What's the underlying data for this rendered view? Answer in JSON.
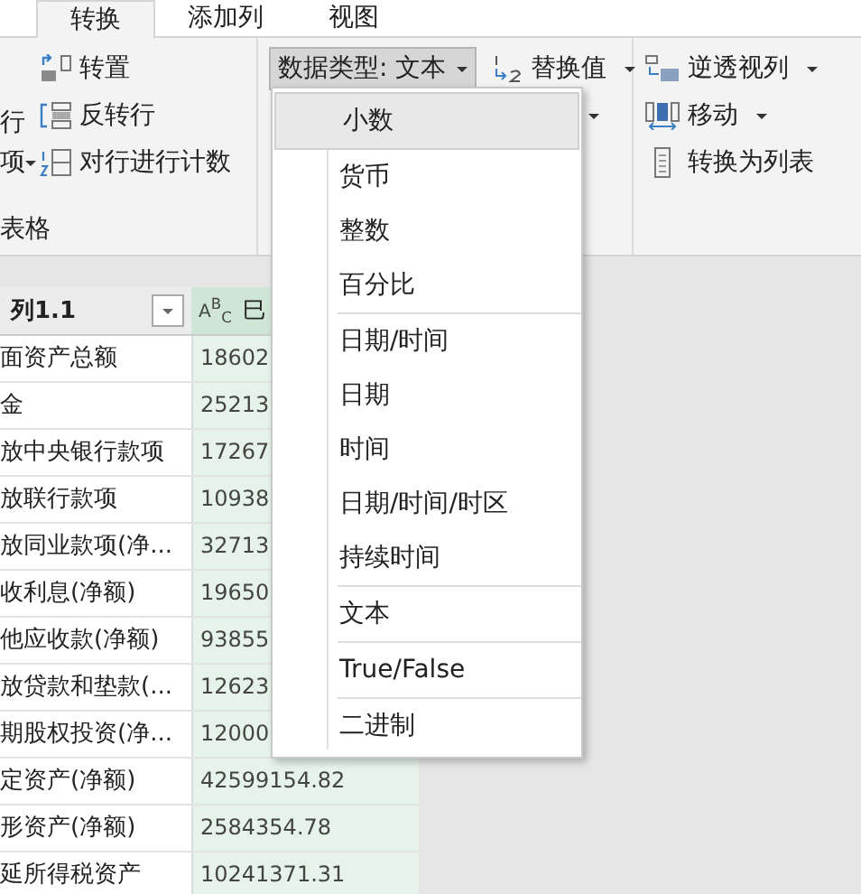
{
  "tabs": [
    {
      "label": "转换",
      "selected": true
    },
    {
      "label": "添加列",
      "selected": false
    },
    {
      "label": "视图",
      "selected": false
    }
  ],
  "ribbon": {
    "left_partial": {
      "lines": [
        "行",
        "项"
      ],
      "group_label": "表格"
    },
    "table_commands": [
      {
        "label": "转置"
      },
      {
        "label": "反转行"
      },
      {
        "label": "对行进行计数"
      }
    ],
    "data_type_button": {
      "label": "数据类型: 文本",
      "pressed": true
    },
    "replace_values": {
      "label": "替换值"
    },
    "unpivot": {
      "label": "逆透视列"
    },
    "move": {
      "label": "移动"
    },
    "to_list": {
      "label": "转换为列表"
    }
  },
  "table": {
    "columns": [
      {
        "label": "列1.1"
      },
      {
        "label": "巳",
        "type_label": "A$^{B}$$_{C}$"
      }
    ],
    "rows": [
      {
        "label": "面资产总额",
        "value": "18602"
      },
      {
        "label": "金",
        "value": "25213"
      },
      {
        "label": "放中央银行款项",
        "value": "17267"
      },
      {
        "label": "放联行款项",
        "value": "10938"
      },
      {
        "label": "放同业款项(净...",
        "value": "32713"
      },
      {
        "label": "收利息(净额)",
        "value": "19650"
      },
      {
        "label": "他应收款(净额)",
        "value": "93855"
      },
      {
        "label": "放贷款和垫款(...",
        "value": "12623"
      },
      {
        "label": "期股权投资(净...",
        "value": "12000"
      },
      {
        "label": "定资产(净额)",
        "value": "42599154.82"
      },
      {
        "label": "形资产(净额)",
        "value": "2584354.78"
      },
      {
        "label": "延所得税资产",
        "value": "10241371.31"
      }
    ]
  },
  "menu": {
    "groups": [
      [
        {
          "label": "小数",
          "selected": true
        },
        {
          "label": "货币",
          "selected": false
        },
        {
          "label": "整数",
          "selected": false
        },
        {
          "label": "百分比",
          "selected": false
        }
      ],
      [
        {
          "label": "日期/时间",
          "selected": false
        },
        {
          "label": "日期",
          "selected": false
        },
        {
          "label": "时间",
          "selected": false
        },
        {
          "label": "日期/时间/时区",
          "selected": false
        },
        {
          "label": "持续时间",
          "selected": false
        }
      ],
      [
        {
          "label": "文本",
          "selected": false
        }
      ],
      [
        {
          "label": "True/False",
          "selected": false
        }
      ],
      [
        {
          "label": "二进制",
          "selected": false
        }
      ]
    ]
  }
}
